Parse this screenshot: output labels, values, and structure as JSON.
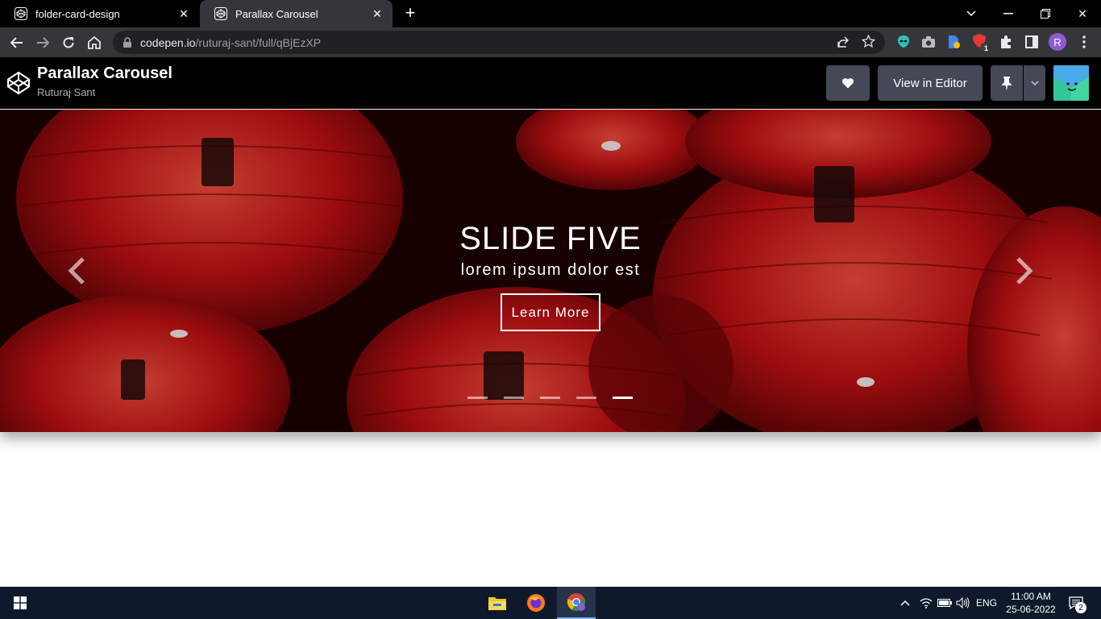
{
  "browser": {
    "tabs": [
      {
        "title": "folder-card-design",
        "active": false
      },
      {
        "title": "Parallax Carousel",
        "active": true
      }
    ],
    "new_tab": "+",
    "url_host": "codepen.io",
    "url_path": "/ruturaj-sant/full/qBjEzXP",
    "profile_initial": "R",
    "extension_badge": "1"
  },
  "codepen": {
    "pen_title": "Parallax Carousel",
    "author": "Ruturaj Sant",
    "view_in_editor": "View in Editor"
  },
  "carousel": {
    "slide_title": "SLIDE FIVE",
    "slide_subtitle": "lorem ipsum dolor est",
    "cta": "Learn More",
    "slide_count": 5,
    "active_index": 4,
    "colors": {
      "lantern": "#b30d0d",
      "background": "#1a0000"
    }
  },
  "taskbar": {
    "language": "ENG",
    "time": "11:00 AM",
    "date": "25-06-2022",
    "notification_count": "2"
  }
}
